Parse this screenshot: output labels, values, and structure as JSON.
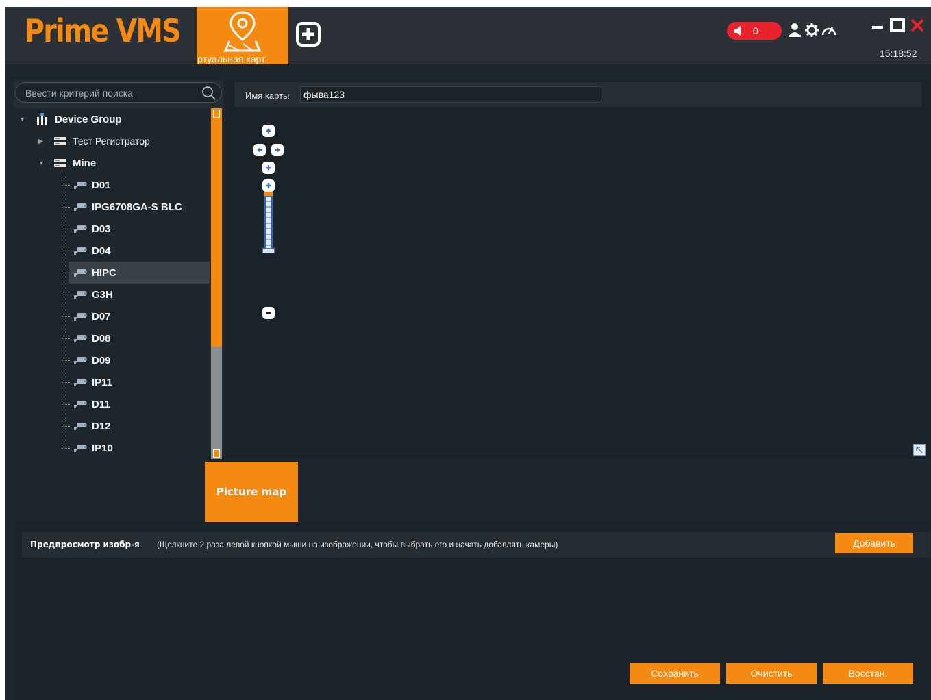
{
  "app": {
    "logo": "Prime VMS",
    "module_tab_label": "Виртуальная карт",
    "alarm_count": "0",
    "clock": "15:18:52"
  },
  "search": {
    "placeholder": "Ввести критерий поиска"
  },
  "tree": {
    "root": "Device Group",
    "groups": [
      {
        "label": "Тест Регистратор",
        "expanded": false
      },
      {
        "label": "Mine",
        "expanded": true
      }
    ],
    "devices": [
      "D01",
      "IPG6708GA-S BLC",
      "D03",
      "D04",
      "HIPC",
      "G3H",
      "D07",
      "D08",
      "D09",
      "IP11",
      "D11",
      "D12",
      "IP10"
    ],
    "selected": "HIPC"
  },
  "map": {
    "name_label": "Имя карты",
    "name_value": "фыва123"
  },
  "map_type_tab": "Picture map",
  "preview": {
    "title": "Предпросмотр изобр-я",
    "hint": "(Щелкните 2 раза левой кнопкой мыши на изображении, чтобы выбрать его и начать добавлять камеры)",
    "add_label": "Добавить"
  },
  "actions": {
    "save_label": "Сохранить",
    "clear_label": "Очистить",
    "restore_label": "Восстан."
  },
  "colors": {
    "accent": "#f58a12",
    "background": "#1d262d",
    "alarm": "#e8232e"
  }
}
